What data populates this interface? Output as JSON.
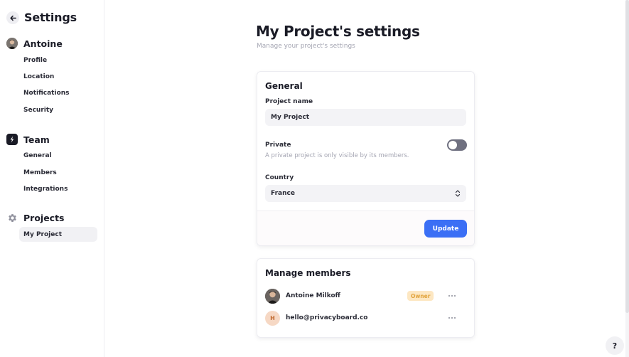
{
  "sidebar": {
    "title": "Settings",
    "account": {
      "name": "Antoine",
      "items": [
        "Profile",
        "Location",
        "Notifications",
        "Security"
      ]
    },
    "team": {
      "name": "Team",
      "items": [
        "General",
        "Members",
        "Integrations"
      ]
    },
    "projects": {
      "name": "Projects",
      "items": [
        "My Project"
      ]
    }
  },
  "main": {
    "title": "My Project's settings",
    "subtitle": "Manage your project's settings"
  },
  "general": {
    "title": "General",
    "project_name_label": "Project name",
    "project_name_value": "My Project",
    "private_label": "Private",
    "private_help": "A private project is only visible by its members.",
    "private_enabled": false,
    "country_label": "Country",
    "country_value": "France",
    "update_label": "Update"
  },
  "members": {
    "title": "Manage members",
    "list": [
      {
        "name": "Antoine Milkoff",
        "badge": "Owner"
      },
      {
        "name": "hello@privacyboard.co",
        "initial": "H"
      }
    ]
  },
  "help_label": "?",
  "colors": {
    "accent": "#3b6ff5",
    "owner_badge_bg": "#fde7c2",
    "owner_badge_text": "#e1a33c"
  }
}
